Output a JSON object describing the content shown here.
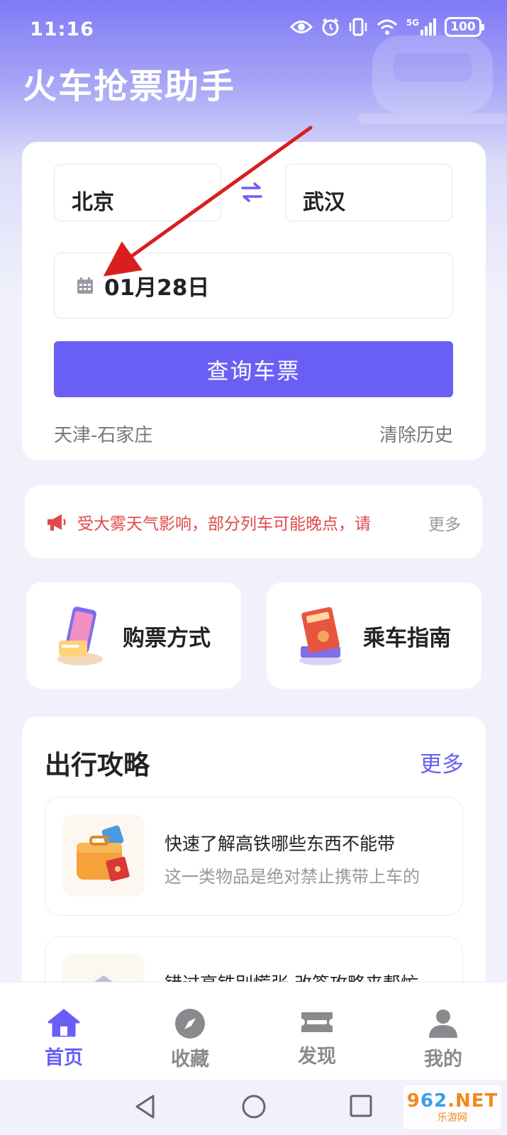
{
  "status_bar": {
    "time": "11:16",
    "network_label": "5G",
    "battery": "100"
  },
  "app": {
    "title": "火车抢票助手"
  },
  "search": {
    "from_city": "北京",
    "to_city": "武汉",
    "date": "01月28日",
    "query_button": "查询车票",
    "history_item": "天津-石家庄",
    "clear_history": "清除历史"
  },
  "notice": {
    "text": "受大雾天气影响，部分列车可能晚点，请",
    "more": "更多",
    "color": "#e0494a"
  },
  "features": [
    {
      "label": "购票方式",
      "icon": "phone-ticket-icon"
    },
    {
      "label": "乘车指南",
      "icon": "guide-book-icon"
    }
  ],
  "strategy": {
    "title": "出行攻略",
    "more": "更多",
    "articles": [
      {
        "title": "快速了解高铁哪些东西不能带",
        "subtitle": "这一类物品是绝对禁止携带上车的",
        "icon": "luggage-icon"
      },
      {
        "title": "错过高铁别慌张 改签攻略来帮忙",
        "subtitle": "",
        "icon": "ticket-icon"
      }
    ]
  },
  "tabs": [
    {
      "label": "首页",
      "icon": "home-icon",
      "active": true
    },
    {
      "label": "收藏",
      "icon": "compass-icon",
      "active": false
    },
    {
      "label": "发现",
      "icon": "ticket-icon",
      "active": false
    },
    {
      "label": "我的",
      "icon": "user-icon",
      "active": false
    }
  ],
  "watermark": {
    "main_prefix": "9",
    "main_middle": "62",
    "main_suffix": ".NET",
    "sub": "乐游网"
  },
  "colors": {
    "accent": "#6a5ff5",
    "header_gradient_top": "#7f7af7",
    "annotation_arrow": "#d81e1e"
  }
}
